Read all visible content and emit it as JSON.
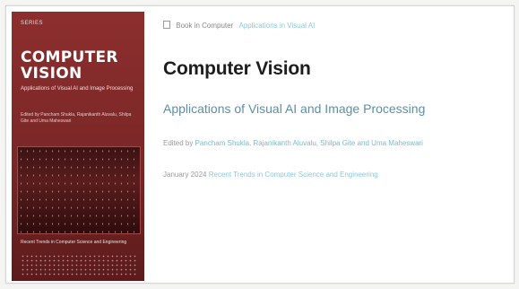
{
  "cover": {
    "series": "SERIES",
    "title": "COMPUTER VISION",
    "subtitle": "Applications of Visual AI and Image Processing",
    "authors": "Edited by Pancham Shukla, Rajanikanth Aluvalu, Shilpa Gite and Uma Maheswari",
    "footer": "Recent Trends in Computer Science and Engineering",
    "colors": {
      "primary": "#8d2e2e",
      "accent": "#ffffff"
    }
  },
  "breadcrumb": {
    "icon": "book-icon",
    "label": "Book in Computer",
    "link": "Applications in Visual AI"
  },
  "title": "Computer Vision",
  "subtitle": "Applications of Visual AI and Image Processing",
  "editors": {
    "prefix": "Edited by",
    "names": "Pancham Shukla, Rajanikanth Aluvalu, Shilpa Gite and Uma Maheswari"
  },
  "release": {
    "date": "January 2024",
    "series": "Recent Trends in Computer Science and Engineering"
  },
  "colors": {
    "title": "#1e1e1e",
    "subtitle": "#5b8fa8",
    "link": "#7ab8cc"
  }
}
